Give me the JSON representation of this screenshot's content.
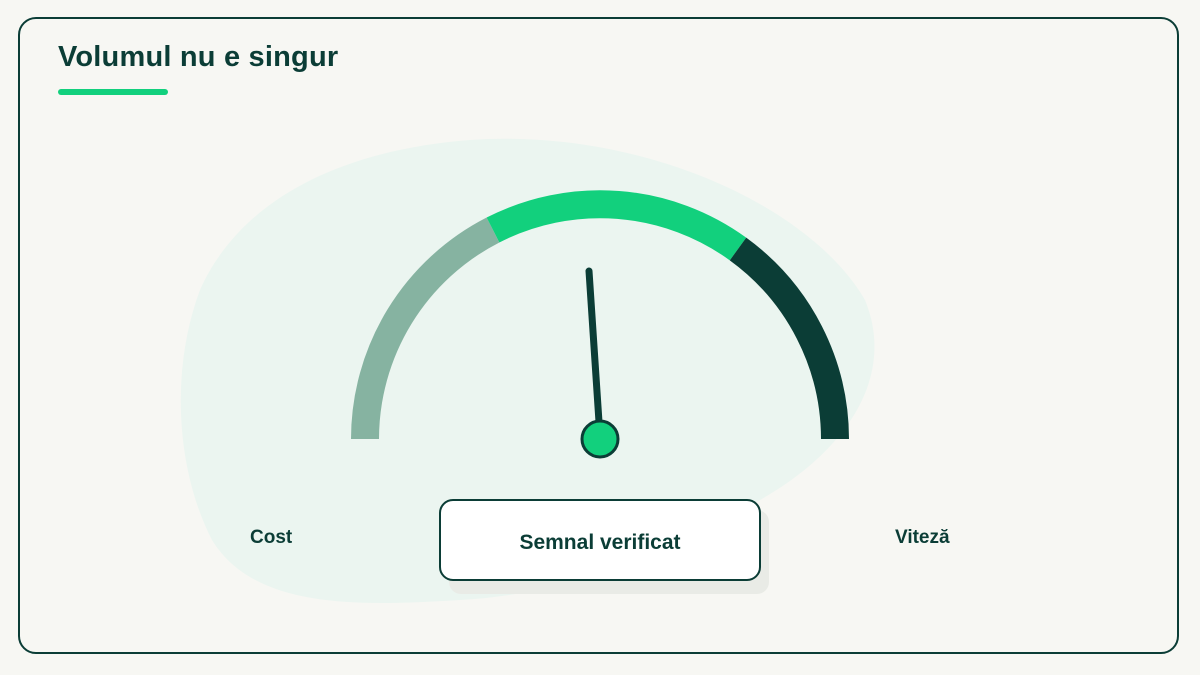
{
  "title": "Volumul nu e singur",
  "gauge": {
    "left_label": "Cost",
    "right_label": "Viteză",
    "status_label": "Semnal verificat",
    "segment_colors": [
      "#86b3a1",
      "#12d07d",
      "#0b3d36"
    ],
    "needle_color": "#0b3d36",
    "hub_color": "#12d07d"
  },
  "colors": {
    "accent": "#12d07d",
    "ink": "#0b3d36",
    "background": "#f7f7f3",
    "blob": "#ebf5f0"
  }
}
